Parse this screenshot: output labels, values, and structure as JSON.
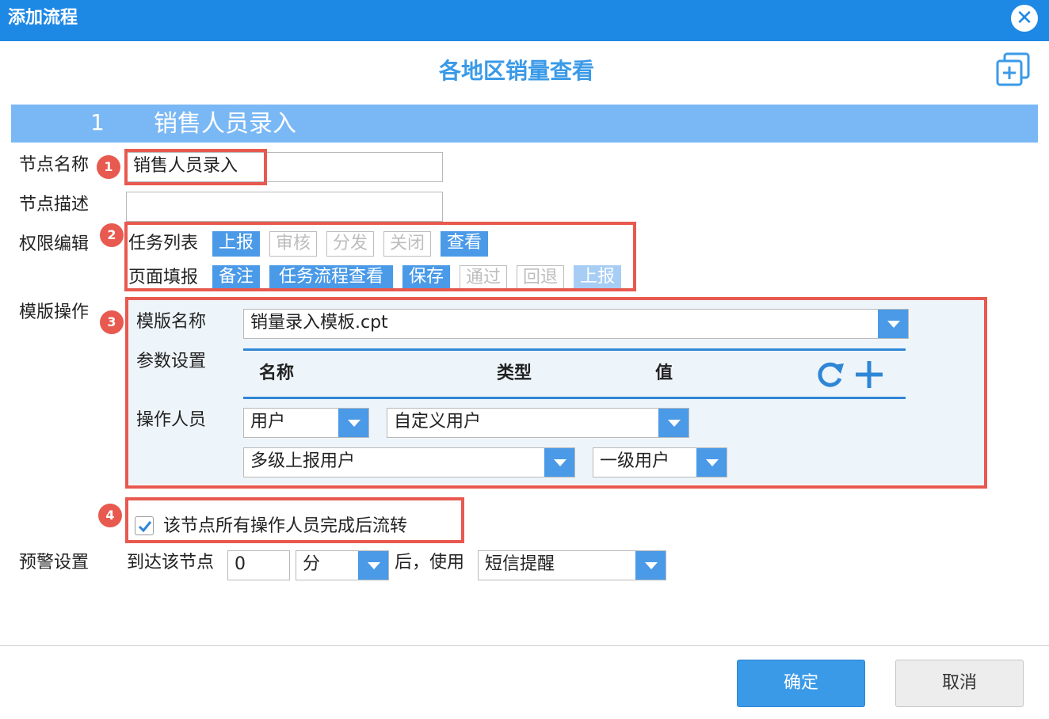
{
  "dialog": {
    "title": "添加流程",
    "close_icon": "close-icon"
  },
  "flow": {
    "title": "各地区销量查看"
  },
  "node": {
    "number": "1",
    "name": "销售人员录入"
  },
  "labels": {
    "node_name": "节点名称",
    "node_desc": "节点描述",
    "permission": "权限编辑",
    "template_ops": "模版操作",
    "warning": "预警设置"
  },
  "badges": [
    "1",
    "2",
    "3",
    "4"
  ],
  "fields": {
    "node_name_value": "销售人员录入",
    "node_desc_value": ""
  },
  "permissions": {
    "task_list_label": "任务列表",
    "task_list": [
      {
        "label": "上报",
        "state": "on"
      },
      {
        "label": "审核",
        "state": "off"
      },
      {
        "label": "分发",
        "state": "off"
      },
      {
        "label": "关闭",
        "state": "off"
      },
      {
        "label": "查看",
        "state": "on"
      }
    ],
    "page_fill_label": "页面填报",
    "page_fill": [
      {
        "label": "备注",
        "state": "on"
      },
      {
        "label": "任务流程查看",
        "state": "on"
      },
      {
        "label": "保存",
        "state": "on"
      },
      {
        "label": "通过",
        "state": "off"
      },
      {
        "label": "回退",
        "state": "off"
      },
      {
        "label": "上报",
        "state": "dim"
      }
    ]
  },
  "template": {
    "name_label": "模版名称",
    "name_value": "销量录入模板.cpt",
    "param_label": "参数设置",
    "columns": [
      "名称",
      "类型",
      "值"
    ],
    "operator_label": "操作人员",
    "operator_type": "用户",
    "user_kind": "自定义用户",
    "multi_level": "多级上报用户",
    "level": "一级用户"
  },
  "checkbox": {
    "label": "该节点所有操作人员完成后流转",
    "checked": true
  },
  "warning": {
    "prefix": "到达该节点",
    "amount": "0",
    "unit": "分",
    "suffix": "后，使用",
    "method": "短信提醒"
  },
  "footer": {
    "ok": "确定",
    "cancel": "取消"
  },
  "colors": {
    "accent": "#1e88e5",
    "highlight": "#e8594f",
    "node_bar": "#7ab8f5"
  }
}
